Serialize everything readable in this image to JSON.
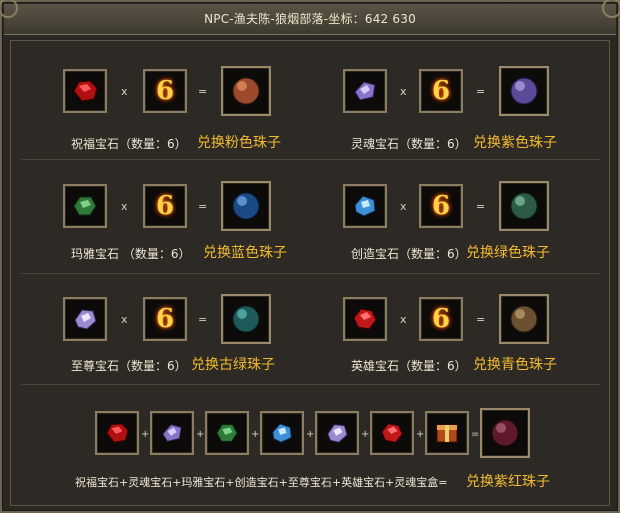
{
  "window": {
    "title": "NPC-渔夫陈-狼烟部落-坐标：642 630"
  },
  "multiplier": "x",
  "equals": "=",
  "count_value": "6",
  "rows": [
    {
      "left": {
        "label": "祝福宝石（数量：6）",
        "action": "兑换粉色珠子"
      },
      "right": {
        "label": "灵魂宝石（数量：6）",
        "action": "兑换紫色珠子"
      }
    },
    {
      "left": {
        "label": "玛雅宝石 （数量：6）",
        "action": "兑换蓝色珠子"
      },
      "right": {
        "label": "创造宝石（数量：6）",
        "action": "兑换绿色珠子"
      }
    },
    {
      "left": {
        "label": "至尊宝石（数量：6）",
        "action": "兑换古绿珠子"
      },
      "right": {
        "label": "英雄宝石（数量：6）",
        "action": "兑换青色珠子"
      }
    }
  ],
  "combo": {
    "plus": "+",
    "equals": "=",
    "label": "祝福宝石+灵魂宝石+玛雅宝石+创造宝石+至尊宝石+英雄宝石+灵魂宝盒=",
    "action": "兑换紫红珠子"
  }
}
